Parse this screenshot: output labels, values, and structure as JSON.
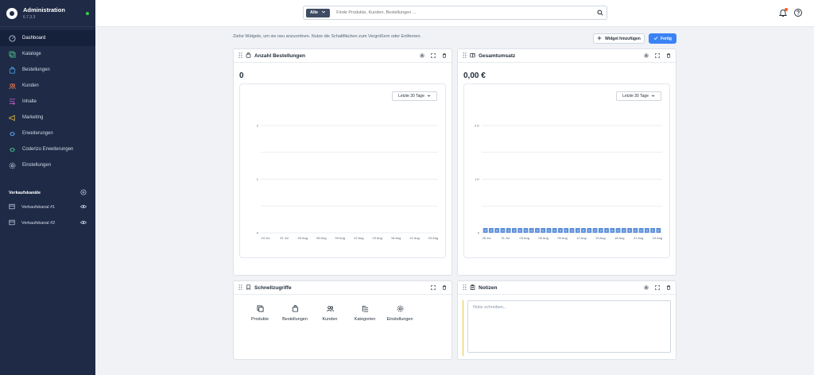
{
  "brand": {
    "name": "Administration",
    "version": "6.7.3.3"
  },
  "nav": [
    {
      "label": "Dashboard",
      "icon": "gauge-icon",
      "active": true
    },
    {
      "label": "Kataloge",
      "icon": "catalog-icon"
    },
    {
      "label": "Bestellungen",
      "icon": "shopping-bag-icon"
    },
    {
      "label": "Kunden",
      "icon": "users-icon"
    },
    {
      "label": "Inhalte",
      "icon": "content-icon"
    },
    {
      "label": "Marketing",
      "icon": "megaphone-icon"
    },
    {
      "label": "Erweiterungen",
      "icon": "plug-icon"
    },
    {
      "label": "Coderizo Erweiterungen",
      "icon": "code-plug-icon"
    },
    {
      "label": "Einstellungen",
      "icon": "gear-icon"
    }
  ],
  "sales_channels": {
    "title": "Verkaufskanäle",
    "items": [
      {
        "label": "Verkaufskanal #1"
      },
      {
        "label": "Verkaufskanal #2"
      }
    ]
  },
  "search": {
    "scope": "Alle",
    "placeholder": "Finde Produkte, Kunden, Bestellungen ..."
  },
  "toolbar": {
    "hint": "Ziehe Widgets, um sie neu anzuordnen. Nutze die Schaltflächen zum Vergrößern oder Entfernen.",
    "add_widget": "Widget hinzufügen",
    "done": "Fertig"
  },
  "widgets": {
    "orders": {
      "title": "Anzahl Bestellungen",
      "value": "0",
      "range": "Letzte 30 Tage"
    },
    "revenue": {
      "title": "Gesamtumsatz",
      "value": "0,00 €",
      "range": "Letzte 30 Tage"
    },
    "quick": {
      "title": "Schnellzugriffe",
      "items": [
        {
          "label": "Produkte",
          "icon": "copy-icon"
        },
        {
          "label": "Bestellungen",
          "icon": "shopping-bag-icon"
        },
        {
          "label": "Kunden",
          "icon": "users-icon"
        },
        {
          "label": "Kategorien",
          "icon": "list-icon"
        },
        {
          "label": "Einstellungen",
          "icon": "gear-icon"
        }
      ]
    },
    "notes": {
      "title": "Notizen",
      "placeholder": "Notiz schreiben..."
    }
  },
  "chart_data": [
    {
      "type": "line",
      "x_ticks": [
        "24 Jul",
        "31 Jul",
        "03 Aug",
        "06 Aug",
        "09 Aug",
        "12 Aug",
        "15 Aug",
        "18 Aug",
        "21 Aug",
        "24 Aug"
      ],
      "y_ticks": [
        "0",
        "1",
        "2"
      ],
      "ylim": [
        0,
        2
      ],
      "grid": true,
      "values": []
    },
    {
      "type": "bar",
      "x_ticks": [
        "26 Jul",
        "31 Jul",
        "03 Aug",
        "06 Aug",
        "09 Aug",
        "12 Aug",
        "15 Aug",
        "18 Aug",
        "21 Aug",
        "24 Aug"
      ],
      "y_ticks": [
        "0",
        "1 K",
        "2 K"
      ],
      "ylim": [
        0,
        2000
      ],
      "grid": true,
      "values": [
        0,
        0,
        0,
        0,
        0,
        0,
        0,
        0,
        0,
        0,
        0,
        0,
        0,
        0,
        0,
        0,
        0,
        0,
        0,
        0,
        0,
        0,
        0,
        0,
        0,
        0,
        0,
        0,
        0,
        0,
        0
      ],
      "data_labels": [
        "0",
        "0",
        "0",
        "0",
        "0",
        "0",
        "0",
        "0",
        "0",
        "0",
        "0",
        "0",
        "0",
        "0",
        "0",
        "0",
        "0",
        "0",
        "0",
        "0",
        "0",
        "0",
        "0",
        "0",
        "0",
        "0",
        "0",
        "0",
        "0",
        "0",
        "0"
      ],
      "bar_color": "#5b8fd9"
    }
  ],
  "colors": {
    "accent": "#3b82f6",
    "sidebar": "#1e2a46",
    "status": "#37d046",
    "badge": "#ff5c26",
    "note_bar": "#f0c63a"
  }
}
